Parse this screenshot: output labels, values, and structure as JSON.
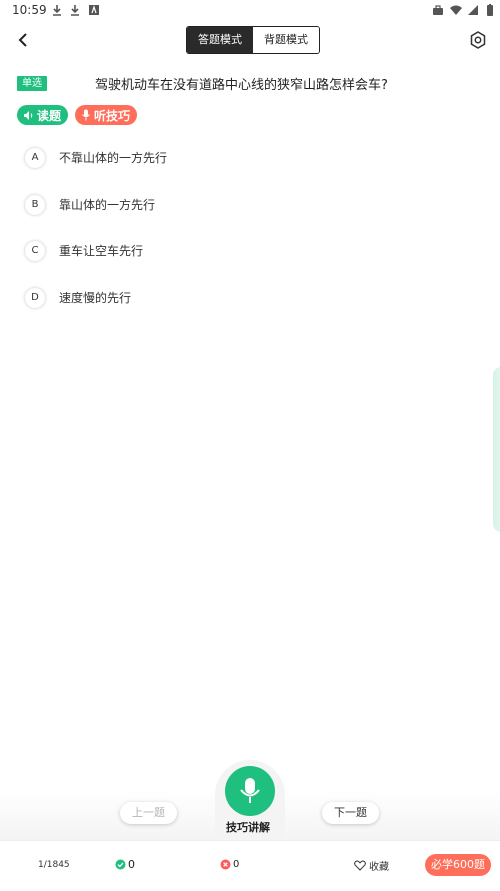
{
  "status_bar": {
    "time": "10:59"
  },
  "header": {
    "modes": [
      {
        "label": "答题模式",
        "active": true
      },
      {
        "label": "背题模式",
        "active": false
      }
    ]
  },
  "question": {
    "type": "单选",
    "text": "驾驶机动车在没有道路中心线的狭窄山路怎样会车?",
    "read_label": "读题",
    "listen_label": "听技巧",
    "options": [
      {
        "letter": "A",
        "text": "不靠山体的一方先行"
      },
      {
        "letter": "B",
        "text": "靠山体的一方先行"
      },
      {
        "letter": "C",
        "text": "重车让空车先行"
      },
      {
        "letter": "D",
        "text": "速度慢的先行"
      }
    ]
  },
  "controls": {
    "prev_label": "上一题",
    "next_label": "下一题",
    "mic_label": "技巧讲解"
  },
  "footer": {
    "progress": "1/1845",
    "right_count": "0",
    "wrong_count": "0",
    "collect_label": "收藏",
    "must_learn_label": "必学600题"
  },
  "colors": {
    "accent_green": "#1fbf7f",
    "accent_red": "#ff6e5a"
  }
}
